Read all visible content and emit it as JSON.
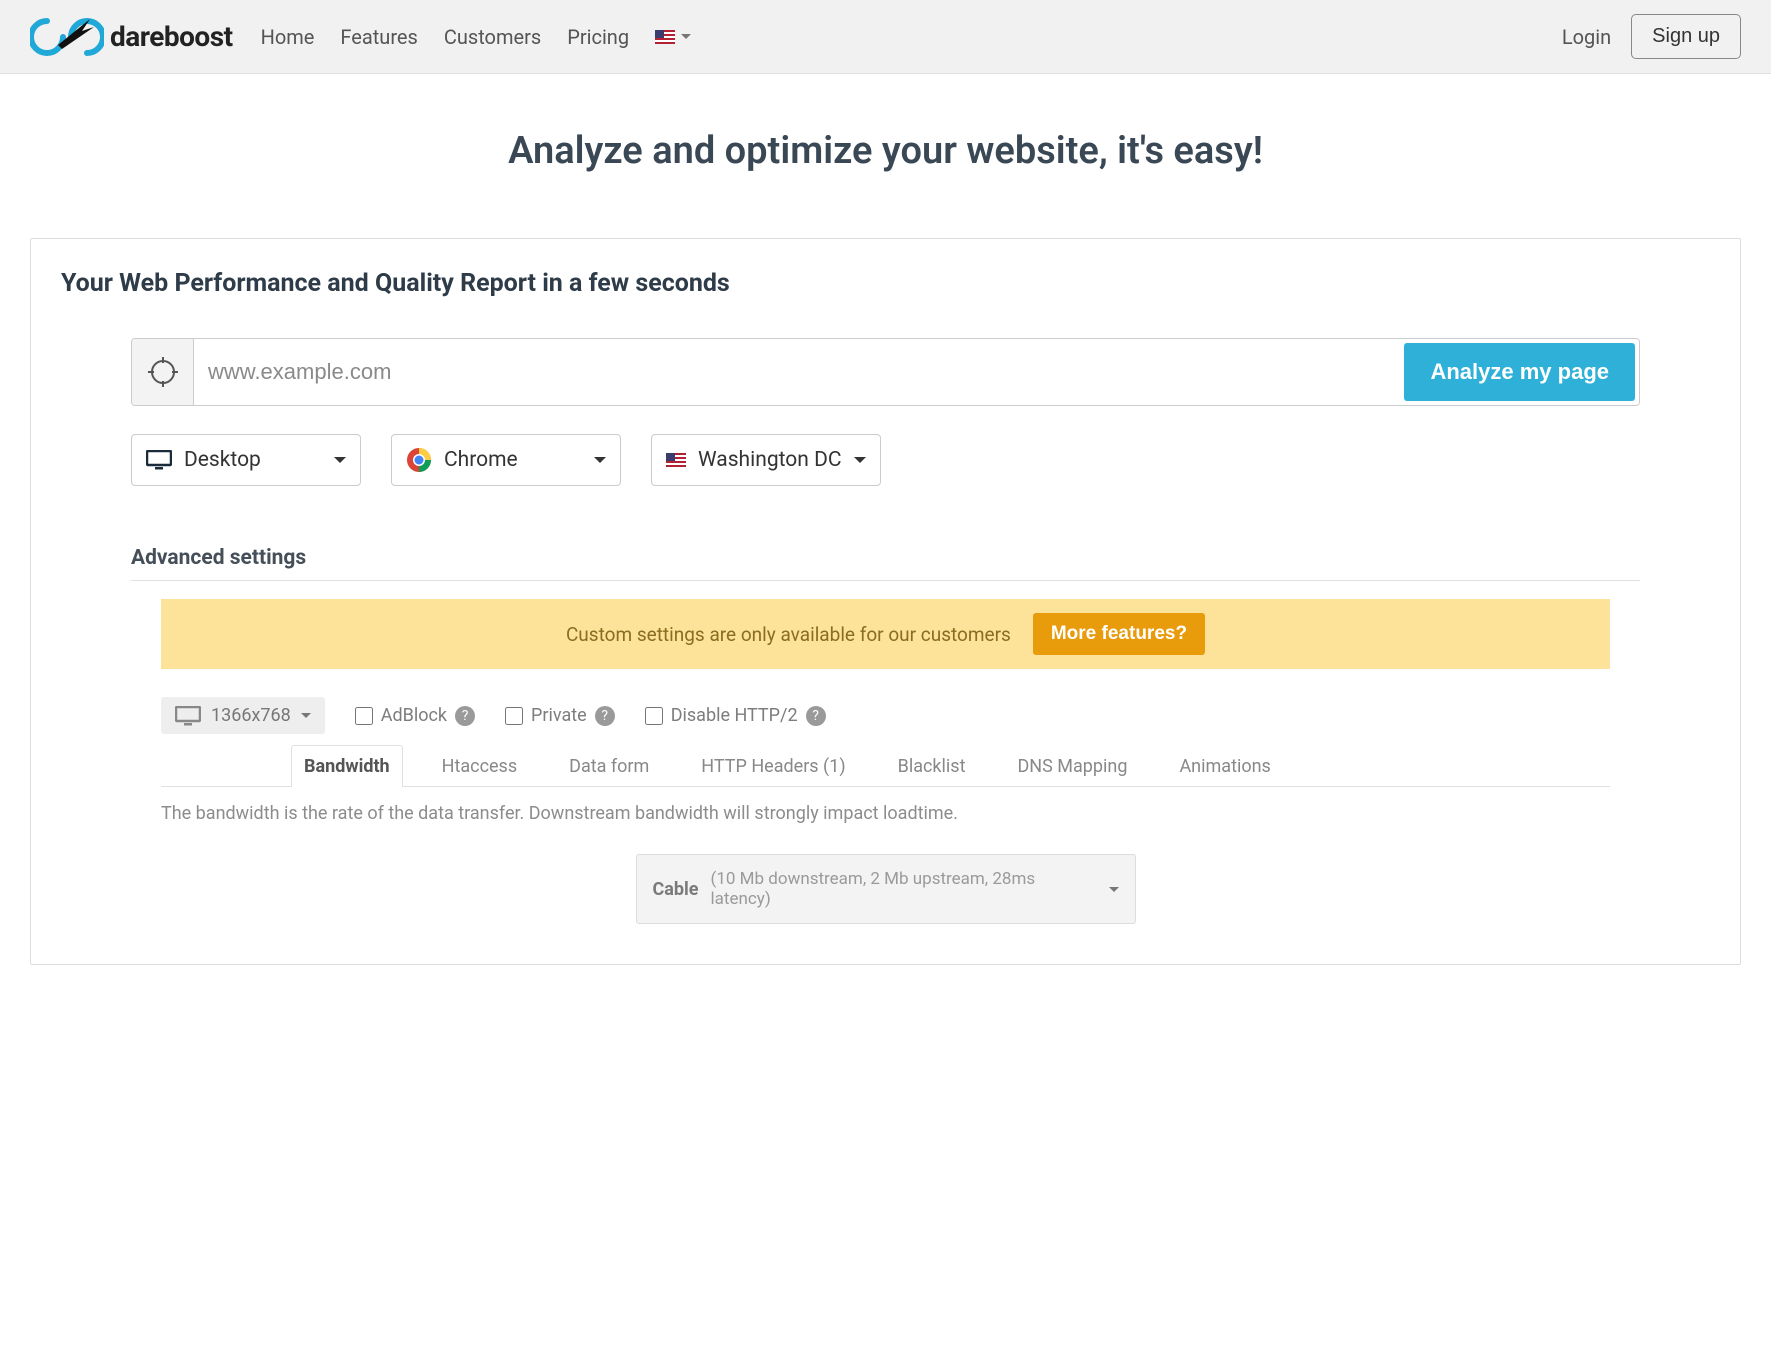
{
  "header": {
    "brand": "dareboost",
    "nav": {
      "home": "Home",
      "features": "Features",
      "customers": "Customers",
      "pricing": "Pricing"
    },
    "login": "Login",
    "signup": "Sign up"
  },
  "hero": {
    "title": "Analyze and optimize your website, it's easy!"
  },
  "card": {
    "title": "Your Web Performance and Quality Report in a few seconds",
    "placeholder": "www.example.com",
    "analyze_btn": "Analyze my page",
    "device": "Desktop",
    "browser": "Chrome",
    "location": "Washington DC"
  },
  "advanced": {
    "title": "Advanced settings",
    "banner_text": "Custom settings are only available for our customers",
    "banner_btn": "More features?",
    "resolution": "1366x768",
    "adblock": "AdBlock",
    "private": "Private",
    "disable_http2": "Disable HTTP/2",
    "tabs": {
      "bandwidth": "Bandwidth",
      "htaccess": "Htaccess",
      "dataform": "Data form",
      "httpheaders": "HTTP Headers (1)",
      "blacklist": "Blacklist",
      "dnsmapping": "DNS Mapping",
      "animations": "Animations"
    },
    "bandwidth_desc": "The bandwidth is the rate of the data transfer. Downstream bandwidth will strongly impact loadtime.",
    "profile_name": "Cable",
    "profile_detail": "(10 Mb downstream, 2 Mb upstream, 28ms latency)"
  }
}
